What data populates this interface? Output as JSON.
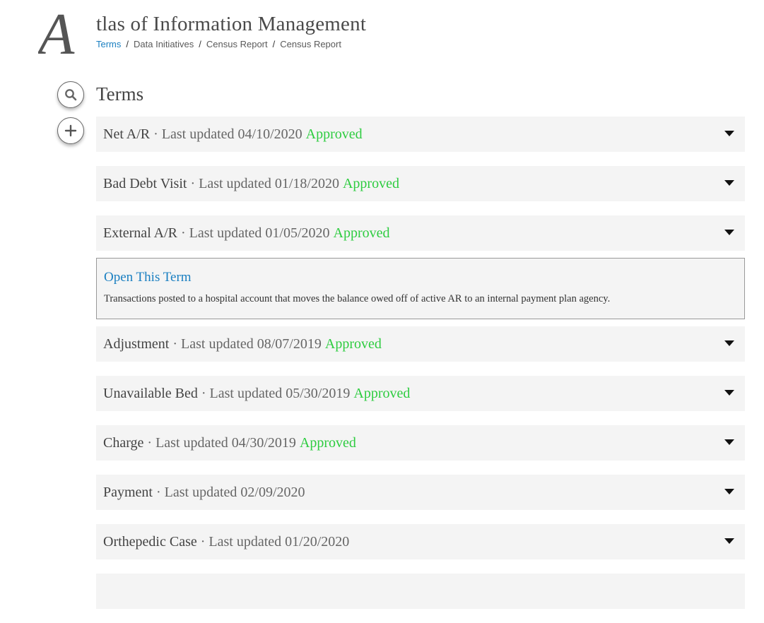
{
  "site": {
    "logo_letter": "A",
    "title": "tlas of Information Management"
  },
  "breadcrumb": [
    {
      "label": "Terms",
      "active": true
    },
    {
      "label": "Data Initiatives",
      "active": false
    },
    {
      "label": "Census Report",
      "active": false
    },
    {
      "label": "Census Report",
      "active": false
    }
  ],
  "breadcrumb_separator": "/",
  "side_actions": {
    "search_icon": "search-icon",
    "add_icon": "plus-icon"
  },
  "section_title": "Terms",
  "colors": {
    "approved": "#2ecc40",
    "link": "#1a7fc1",
    "row_bg": "#f4f4f4"
  },
  "terms": [
    {
      "name": "Net A/R",
      "meta": "· Last updated 04/10/2020",
      "status": "Approved"
    },
    {
      "name": "Bad Debt Visit",
      "meta": "· Last updated 01/18/2020",
      "status": "Approved"
    },
    {
      "name": "External A/R",
      "meta": "· Last updated 01/05/2020",
      "status": "Approved",
      "expanded": true,
      "detail": {
        "link_label": "Open This Term",
        "description": "Transactions posted to a hospital account that moves the balance owed off of active AR to an internal payment plan agency."
      }
    },
    {
      "name": "Adjustment",
      "meta": "· Last updated 08/07/2019",
      "status": "Approved"
    },
    {
      "name": "Unavailable Bed",
      "meta": "· Last updated 05/30/2019",
      "status": "Approved"
    },
    {
      "name": "Charge",
      "meta": "· Last updated 04/30/2019",
      "status": "Approved"
    },
    {
      "name": "Payment",
      "meta": "· Last updated 02/09/2020",
      "status": ""
    },
    {
      "name": "Orthepedic Case",
      "meta": "· Last updated 01/20/2020",
      "status": ""
    },
    {
      "name": "",
      "meta": "",
      "status": ""
    }
  ]
}
